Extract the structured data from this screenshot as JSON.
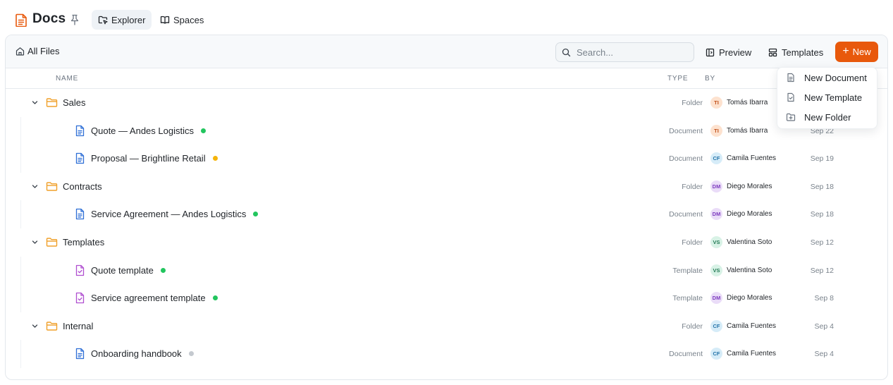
{
  "app": {
    "title": "Docs"
  },
  "tabs": [
    {
      "label": "Explorer",
      "active": true
    },
    {
      "label": "Spaces",
      "active": false
    }
  ],
  "toolbar": {
    "breadcrumb": "All Files",
    "search_placeholder": "Search...",
    "preview_label": "Preview",
    "templates_label": "Templates",
    "new_label": "New",
    "accent_color": "#e8590c"
  },
  "table": {
    "headers": {
      "name": "NAME",
      "type": "TYPE",
      "by": "BY"
    },
    "rows": [
      {
        "kind": "folder",
        "name": "Sales",
        "type": "Folder",
        "initials": "TI",
        "by": "Tomás Ibarra",
        "date": "",
        "status": ""
      },
      {
        "kind": "document",
        "name": "Quote — Andes Logistics",
        "type": "Document",
        "initials": "TI",
        "by": "Tomás Ibarra",
        "date": "Sep 22",
        "status": "green"
      },
      {
        "kind": "document",
        "name": "Proposal — Brightline Retail",
        "type": "Document",
        "initials": "CF",
        "by": "Camila Fuentes",
        "date": "Sep 19",
        "status": "amber"
      },
      {
        "kind": "folder",
        "name": "Contracts",
        "type": "Folder",
        "initials": "DM",
        "by": "Diego Morales",
        "date": "Sep 18",
        "status": ""
      },
      {
        "kind": "document",
        "name": "Service Agreement — Andes Logistics",
        "type": "Document",
        "initials": "DM",
        "by": "Diego Morales",
        "date": "Sep 18",
        "status": "green"
      },
      {
        "kind": "folder",
        "name": "Templates",
        "type": "Folder",
        "initials": "VS",
        "by": "Valentina Soto",
        "date": "Sep 12",
        "status": ""
      },
      {
        "kind": "template",
        "name": "Quote template",
        "type": "Template",
        "initials": "VS",
        "by": "Valentina Soto",
        "date": "Sep 12",
        "status": "green"
      },
      {
        "kind": "template",
        "name": "Service agreement template",
        "type": "Template",
        "initials": "DM",
        "by": "Diego Morales",
        "date": "Sep 8",
        "status": "green"
      },
      {
        "kind": "folder",
        "name": "Internal",
        "type": "Folder",
        "initials": "CF",
        "by": "Camila Fuentes",
        "date": "Sep 4",
        "status": ""
      },
      {
        "kind": "document",
        "name": "Onboarding handbook",
        "type": "Document",
        "initials": "CF",
        "by": "Camila Fuentes",
        "date": "Sep 4",
        "status": "gray"
      }
    ]
  },
  "new_menu": {
    "items": [
      {
        "label": "New Document",
        "icon": "document-icon"
      },
      {
        "label": "New Template",
        "icon": "template-icon"
      },
      {
        "label": "New Folder",
        "icon": "folder-plus-icon"
      }
    ]
  },
  "colors": {
    "folder": "#f0a02a",
    "document": "#2f6fd6",
    "template": "#b04fd0",
    "status_green": "#22c55e",
    "status_amber": "#f5b40a",
    "status_gray": "#c4c9cf"
  }
}
